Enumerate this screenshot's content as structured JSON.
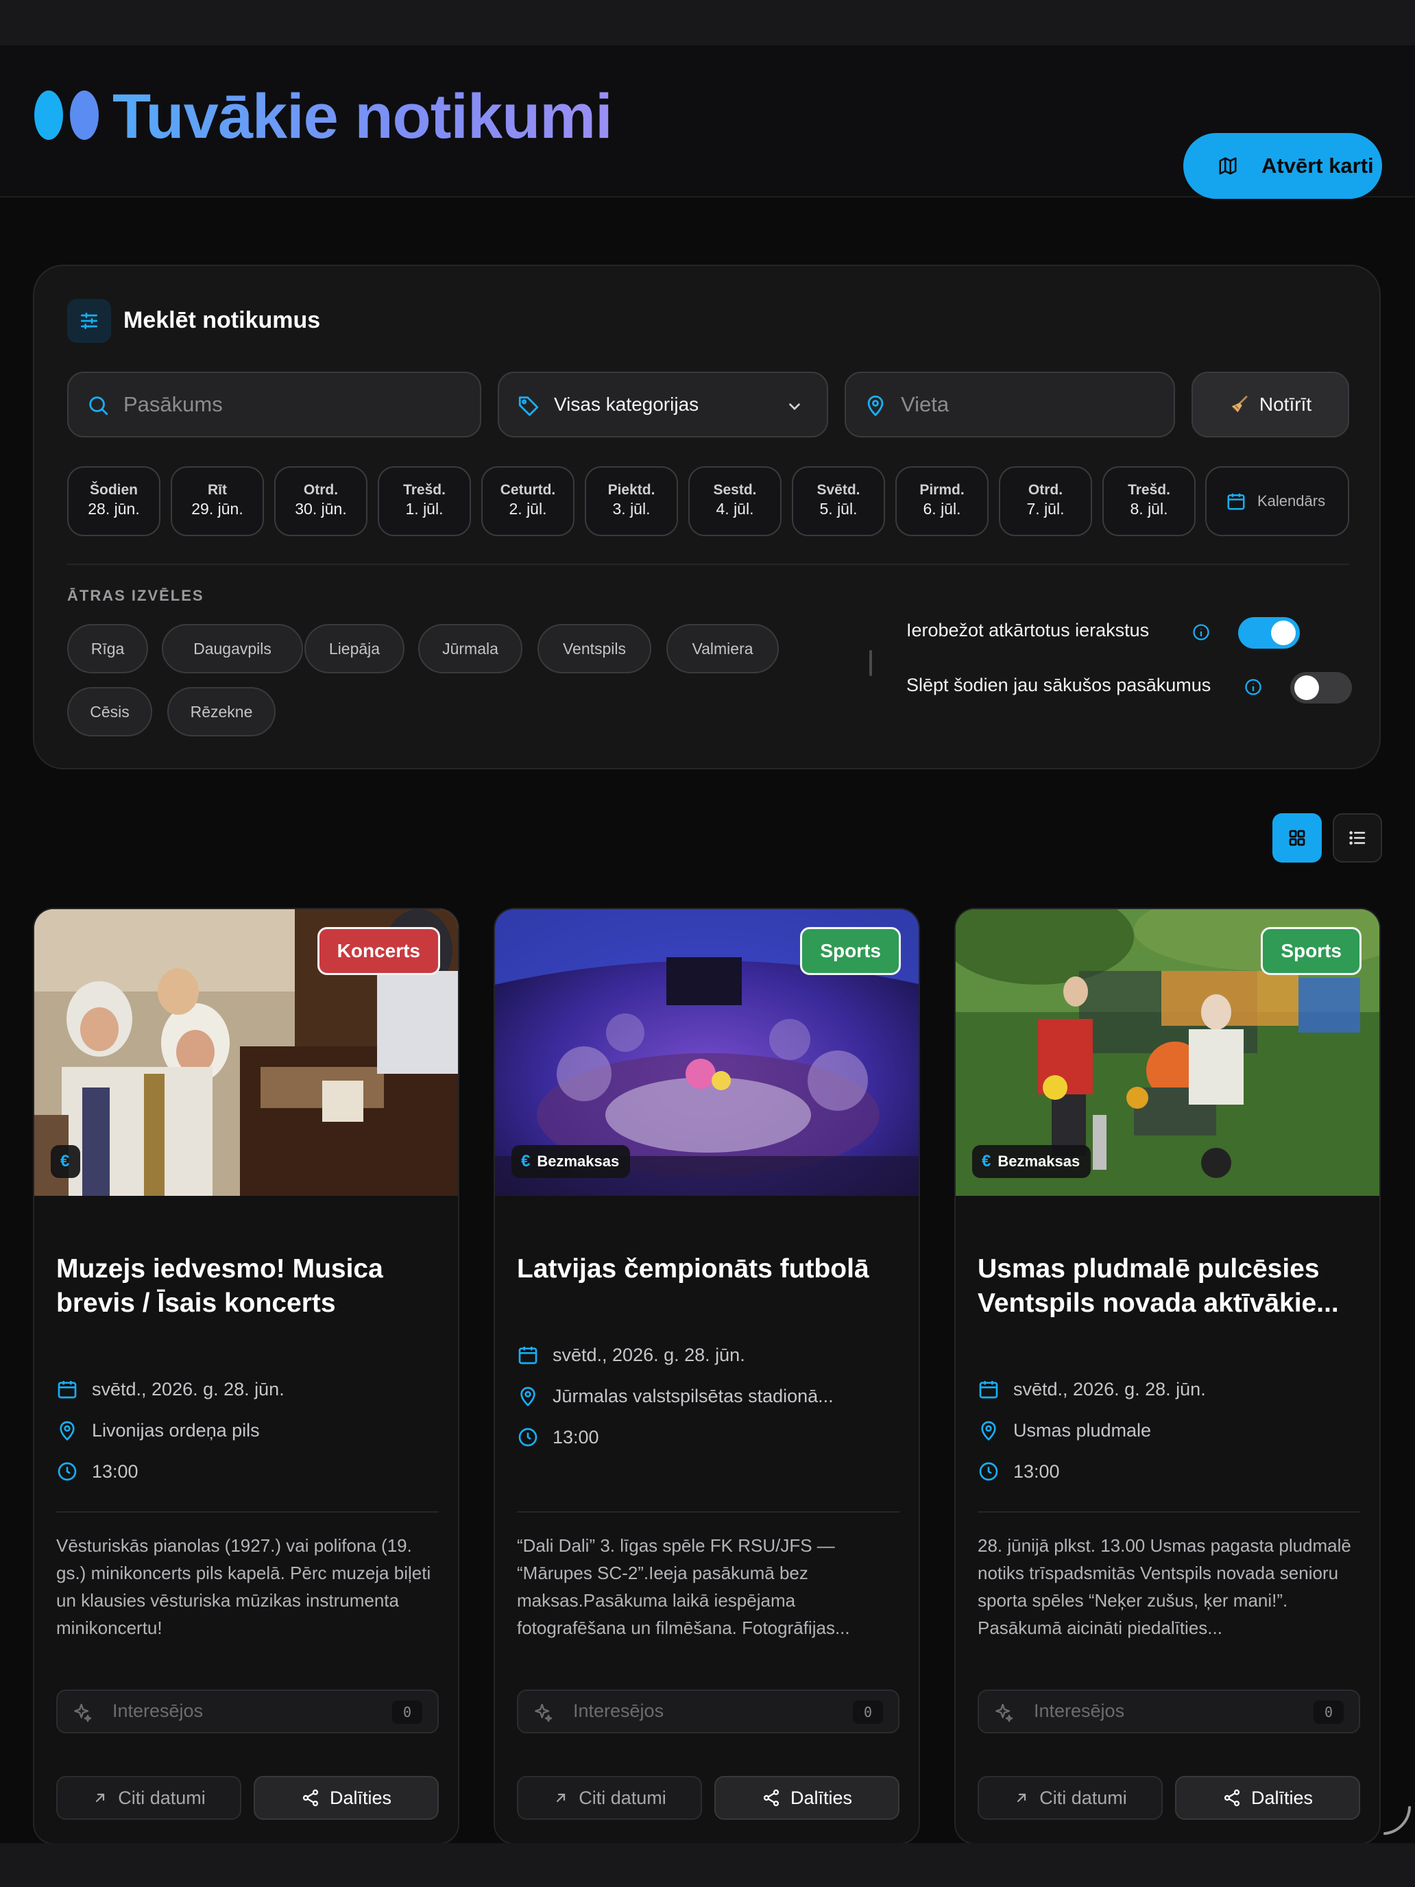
{
  "header": {
    "title": "Tuvākie notikumi",
    "map_button": "Atvērt karti",
    "logo_icon": "logo-mark"
  },
  "search": {
    "panel_title": "Meklēt notikumus",
    "event_placeholder": "Pasākums",
    "category_value": "Visas kategorijas",
    "place_placeholder": "Vieta",
    "clear_label": "Notīrīt",
    "calendar_label": "Kalendārs",
    "days": [
      {
        "name": "Šodien",
        "date": "28. jūn."
      },
      {
        "name": "Rīt",
        "date": "29. jūn."
      },
      {
        "name": "Otrd.",
        "date": "30. jūn."
      },
      {
        "name": "Trešd.",
        "date": "1. jūl."
      },
      {
        "name": "Ceturtd.",
        "date": "2. jūl."
      },
      {
        "name": "Piektd.",
        "date": "3. jūl."
      },
      {
        "name": "Sestd.",
        "date": "4. jūl."
      },
      {
        "name": "Svētd.",
        "date": "5. jūl."
      },
      {
        "name": "Pirmd.",
        "date": "6. jūl."
      },
      {
        "name": "Otrd.",
        "date": "7. jūl."
      },
      {
        "name": "Trešd.",
        "date": "8. jūl."
      }
    ],
    "quick_title": "ĀTRAS IZVĒLES",
    "cities": [
      "Rīga",
      "Daugavpils",
      "Liepāja",
      "Jūrmala",
      "Ventspils",
      "Valmiera",
      "Cēsis",
      "Rēzekne"
    ],
    "toggles": [
      {
        "label": "Ierobežot atkārtotus ierakstus",
        "on": true
      },
      {
        "label": "Slēpt šodien jau sākušos pasākumus",
        "on": false
      }
    ]
  },
  "colors": {
    "accent": "#16a6ef",
    "background": "#0b0b0c",
    "panel": "#161617",
    "badge_concert": "#c93a3f",
    "badge_sports": "#2f9b55"
  },
  "cards": [
    {
      "category": "Koncerts",
      "price": "",
      "title": "Muzejs iedvesmo! Musica brevis / Īsais koncerts",
      "date": "svētd., 2026. g. 28. jūn.",
      "location": "Livonijas ordeņa pils",
      "time": "13:00",
      "description": "Vēsturiskās pianolas (1927.) vai polifona (19. gs.) minikoncerts pils kapelā. Pērc muzeja biļeti un klausies vēsturiska mūzikas instrumenta minikoncertu!",
      "interest_label": "Interesējos",
      "interest_count": "0",
      "other_dates": "Citi datumi",
      "share": "Dalīties"
    },
    {
      "category": "Sports",
      "price": "Bezmaksas",
      "title": "Latvijas čempionāts futbolā",
      "date": "svētd., 2026. g. 28. jūn.",
      "location": "Jūrmalas valstspilsētas stadionā...",
      "time": "13:00",
      "description": "“Dali Dali” 3. līgas spēle FK RSU/JFS — “Mārupes SC-2”.Ieeja pasākumā bez maksas.Pasākuma laikā iespējama fotografēšana un filmēšana. Fotogrāfijas...",
      "interest_label": "Interesējos",
      "interest_count": "0",
      "other_dates": "Citi datumi",
      "share": "Dalīties"
    },
    {
      "category": "Sports",
      "price": "Bezmaksas",
      "title": "Usmas pludmalē pulcēsies Ventspils novada aktīvākie...",
      "date": "svētd., 2026. g. 28. jūn.",
      "location": "Usmas pludmale",
      "time": "13:00",
      "description": "28. jūnijā plkst. 13.00 Usmas pagasta pludmalē notiks trīspadsmitās Ventspils novada senioru sporta spēles “Neķer zušus, ķer mani!”. Pasākumā aicināti piedalīties...",
      "interest_label": "Interesējos",
      "interest_count": "0",
      "other_dates": "Citi datumi",
      "share": "Dalīties"
    }
  ],
  "euro_symbol": "€"
}
